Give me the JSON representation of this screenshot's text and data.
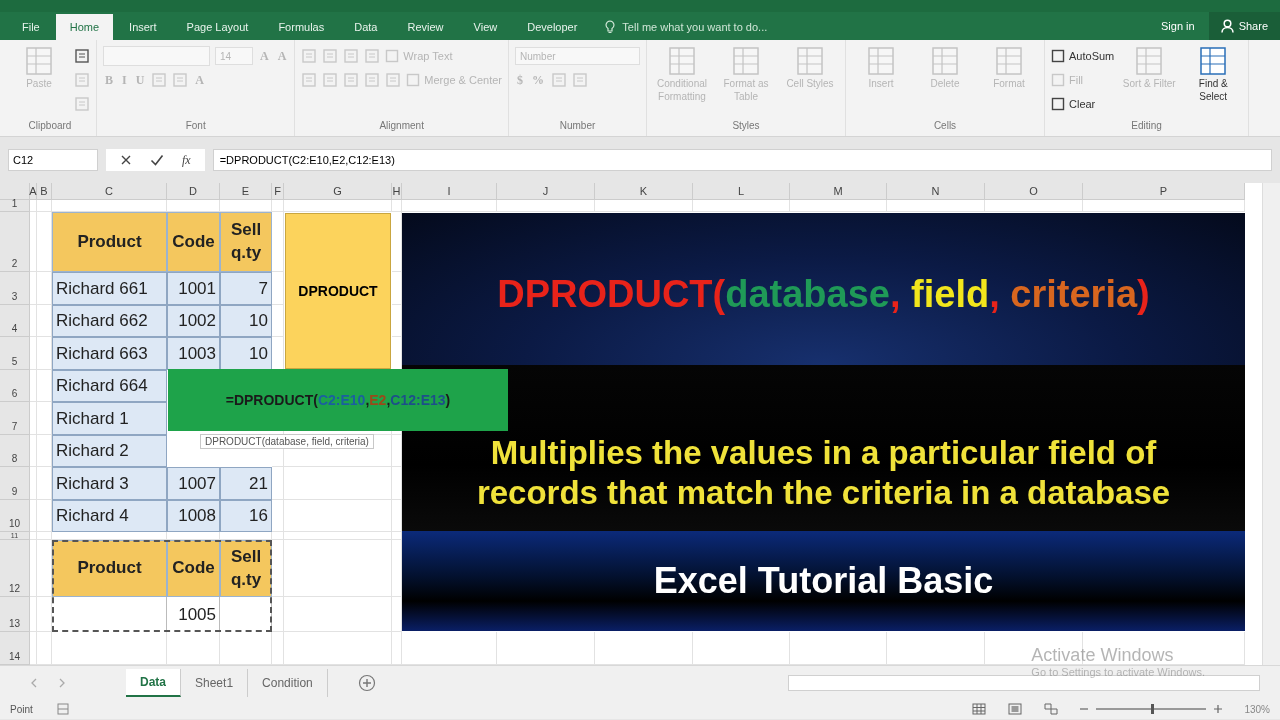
{
  "menu_tabs": [
    {
      "label": "File",
      "selected": false
    },
    {
      "label": "Home",
      "selected": true
    },
    {
      "label": "Insert",
      "selected": false
    },
    {
      "label": "Page Layout",
      "selected": false
    },
    {
      "label": "Formulas",
      "selected": false
    },
    {
      "label": "Data",
      "selected": false
    },
    {
      "label": "Review",
      "selected": false
    },
    {
      "label": "View",
      "selected": false
    },
    {
      "label": "Developer",
      "selected": false
    }
  ],
  "tell_me": {
    "placeholder": "Tell me what you want to do..."
  },
  "account": {
    "sign_in": "Sign in",
    "share": "Share"
  },
  "ribbon": [
    {
      "label": "Clipboard",
      "items": [
        {
          "kind": "large",
          "label": "Paste",
          "disabled": true
        },
        {
          "kind": "stack",
          "lines": [
            [
              {
                "kind": "tool",
                "disabled": false
              }
            ],
            [
              {
                "kind": "tool",
                "disabled": true
              }
            ],
            [
              {
                "kind": "tool",
                "disabled": true
              }
            ]
          ]
        }
      ]
    },
    {
      "label": "Font",
      "items": [
        {
          "kind": "stack",
          "lines": [
            [
              {
                "kind": "fontbox",
                "disabled": true
              },
              {
                "kind": "sizebox",
                "value": "14",
                "disabled": true
              },
              {
                "kind": "glyph",
                "label": "A",
                "disabled": true
              },
              {
                "kind": "glyph",
                "label": "A",
                "disabled": true
              }
            ],
            [
              {
                "kind": "glyph",
                "label": "B",
                "disabled": true
              },
              {
                "kind": "glyph",
                "label": "I",
                "disabled": true
              },
              {
                "kind": "glyph",
                "label": "U",
                "disabled": true
              },
              {
                "kind": "tool",
                "disabled": true
              },
              {
                "kind": "tool",
                "disabled": true
              },
              {
                "kind": "glyph",
                "label": "A",
                "disabled": true
              }
            ]
          ]
        }
      ]
    },
    {
      "label": "Alignment",
      "items": [
        {
          "kind": "stack",
          "lines": [
            [
              {
                "kind": "tool",
                "disabled": true
              },
              {
                "kind": "tool",
                "disabled": true
              },
              {
                "kind": "tool",
                "disabled": true
              },
              {
                "kind": "tool",
                "disabled": true
              },
              {
                "kind": "small",
                "label": "Wrap Text",
                "disabled": true
              }
            ],
            [
              {
                "kind": "tool",
                "disabled": true
              },
              {
                "kind": "tool",
                "disabled": true
              },
              {
                "kind": "tool",
                "disabled": true
              },
              {
                "kind": "tool",
                "disabled": true
              },
              {
                "kind": "tool",
                "disabled": true
              },
              {
                "kind": "small",
                "label": "Merge & Center",
                "disabled": true
              }
            ]
          ]
        }
      ]
    },
    {
      "label": "Number",
      "items": [
        {
          "kind": "stack",
          "lines": [
            [
              {
                "kind": "numberbox",
                "value": "Number",
                "disabled": true
              }
            ],
            [
              {
                "kind": "glyph",
                "label": "$",
                "disabled": true
              },
              {
                "kind": "glyph",
                "label": "%",
                "disabled": true
              },
              {
                "kind": "tool",
                "disabled": true
              },
              {
                "kind": "tool",
                "disabled": true
              }
            ]
          ]
        }
      ]
    },
    {
      "label": "Styles",
      "items": [
        {
          "kind": "large",
          "label": "Conditional Formatting",
          "disabled": true
        },
        {
          "kind": "large",
          "label": "Format as Table",
          "disabled": true
        },
        {
          "kind": "large",
          "label": "Cell Styles",
          "disabled": true
        }
      ]
    },
    {
      "label": "Cells",
      "items": [
        {
          "kind": "large",
          "label": "Insert",
          "disabled": true
        },
        {
          "kind": "large",
          "label": "Delete",
          "disabled": true
        },
        {
          "kind": "large",
          "label": "Format",
          "disabled": true
        }
      ]
    },
    {
      "label": "Editing",
      "items": [
        {
          "kind": "stack",
          "lines": [
            [
              {
                "kind": "small",
                "label": "AutoSum",
                "disabled": false
              }
            ],
            [
              {
                "kind": "small",
                "label": "Fill",
                "disabled": true
              }
            ],
            [
              {
                "kind": "small",
                "label": "Clear",
                "disabled": false
              }
            ]
          ]
        },
        {
          "kind": "large",
          "label": "Sort & Filter",
          "disabled": true
        },
        {
          "kind": "large",
          "label": "Find & Select",
          "disabled": false
        }
      ]
    }
  ],
  "formula_bar": {
    "name_box": "C12",
    "fx": "fx",
    "formula": "=DPRODUCT(C2:E10,E2,C12:E13)"
  },
  "sheet": {
    "columns": [
      "A",
      "B",
      "C",
      "D",
      "E",
      "F",
      "G",
      "H",
      "I",
      "J",
      "K",
      "L",
      "M",
      "N",
      "O",
      "P"
    ],
    "rows": [
      "1",
      "2",
      "3",
      "4",
      "5",
      "6",
      "7",
      "8",
      "9",
      "10",
      "11",
      "12",
      "13",
      "14"
    ],
    "table": {
      "headers": [
        "Product",
        "Code",
        "Sell q.ty"
      ],
      "rows": [
        {
          "product": "Richard 661",
          "code": "1001",
          "qty": "7"
        },
        {
          "product": "Richard 662",
          "code": "1002",
          "qty": "10"
        },
        {
          "product": "Richard 663",
          "code": "1003",
          "qty": "10"
        },
        {
          "product": "Richard 664"
        },
        {
          "product": "Richard 1"
        },
        {
          "product": "Richard 2"
        },
        {
          "product": "Richard 3",
          "code": "1007",
          "qty": "21"
        },
        {
          "product": "Richard 4",
          "code": "1008",
          "qty": "16"
        }
      ]
    },
    "criteria": {
      "headers": [
        "Product",
        "Code",
        "Sell q.ty"
      ],
      "rows": [
        {
          "code": "1005"
        }
      ]
    },
    "label_box": "DPRODUCT",
    "banner": {
      "title_parts": [
        {
          "text": "DPRODUCT(",
          "color": "#e8231a"
        },
        {
          "text": "database",
          "color": "#1f9a57"
        },
        {
          "text": ", ",
          "color": "#e8231a"
        },
        {
          "text": "field",
          "color": "#f2e61c"
        },
        {
          "text": ", ",
          "color": "#e8231a"
        },
        {
          "text": "criteria",
          "color": "#d8661f"
        },
        {
          "text": ")",
          "color": "#e8231a"
        }
      ],
      "description": "Multiplies the values in a particular field of records that match the criteria in a database",
      "footer": "Excel Tutorial Basic"
    },
    "formula_popup": {
      "parts": [
        {
          "text": "=DPRODUCT(",
          "color": "#1a1a1a"
        },
        {
          "text": "C2:E10",
          "color": "#1b5fa0"
        },
        {
          "text": ",",
          "color": "#1a1a1a"
        },
        {
          "text": "E2",
          "color": "#9a4a1a"
        },
        {
          "text": ",",
          "color": "#1a1a1a"
        },
        {
          "text": "C12:E13",
          "color": "#1d4f8a"
        },
        {
          "text": ")",
          "color": "#1a1a1a"
        }
      ],
      "tooltip": "DPRODUCT(database, field, criteria)"
    }
  },
  "sheet_tabs": [
    {
      "label": "Data",
      "selected": true
    },
    {
      "label": "Sheet1",
      "selected": false
    },
    {
      "label": "Condition",
      "selected": false
    }
  ],
  "activation": {
    "title": "Activate Windows",
    "subtitle": "Go to Settings to activate Windows."
  },
  "status_bar": {
    "mode": "Point",
    "zoom_slider": {
      "level": 0.5
    },
    "zoom": "130%"
  }
}
